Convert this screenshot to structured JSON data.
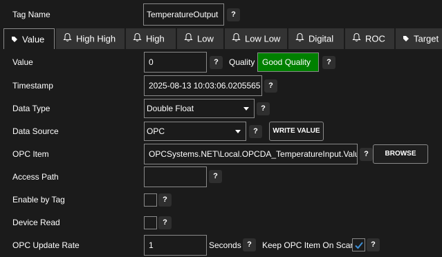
{
  "tag_name": {
    "label": "Tag Name",
    "value": "TemperatureOutput"
  },
  "help_glyph": "?",
  "tabs": [
    {
      "label": "Value",
      "icon": "tag-icon"
    },
    {
      "label": "High High",
      "icon": "bell-icon"
    },
    {
      "label": "High",
      "icon": "bell-icon"
    },
    {
      "label": "Low",
      "icon": "bell-icon"
    },
    {
      "label": "Low Low",
      "icon": "bell-icon"
    },
    {
      "label": "Digital",
      "icon": "bell-icon"
    },
    {
      "label": "ROC",
      "icon": "bell-icon"
    },
    {
      "label": "Target",
      "icon": "tag-icon"
    }
  ],
  "value_row": {
    "label": "Value",
    "value": "0",
    "quality_label": "Quality",
    "quality_value": "Good Quality",
    "quality_color": "#008000"
  },
  "timestamp": {
    "label": "Timestamp",
    "value": "2025-08-13 10:03:06.0205565"
  },
  "data_type": {
    "label": "Data Type",
    "selected": "Double Float"
  },
  "data_source": {
    "label": "Data Source",
    "selected": "OPC",
    "write_button": "WRITE VALUE"
  },
  "opc_item": {
    "label": "OPC Item",
    "value": "OPCSystems.NET\\Local.OPCDA_TemperatureInput.Value",
    "browse_button": "BROWSE"
  },
  "access_path": {
    "label": "Access Path",
    "value": ""
  },
  "enable_by_tag": {
    "label": "Enable by Tag",
    "checked": false
  },
  "device_read": {
    "label": "Device Read",
    "checked": false
  },
  "opc_update_rate": {
    "label": "OPC Update Rate",
    "value": "1",
    "units": "Seconds",
    "keep_label": "Keep OPC Item On Scan",
    "keep_checked": true
  },
  "colors": {
    "background": "#1b1b1b",
    "tab_inactive": "#333333",
    "border": "#8a8a8a",
    "check_accent": "#3d8fd6"
  }
}
